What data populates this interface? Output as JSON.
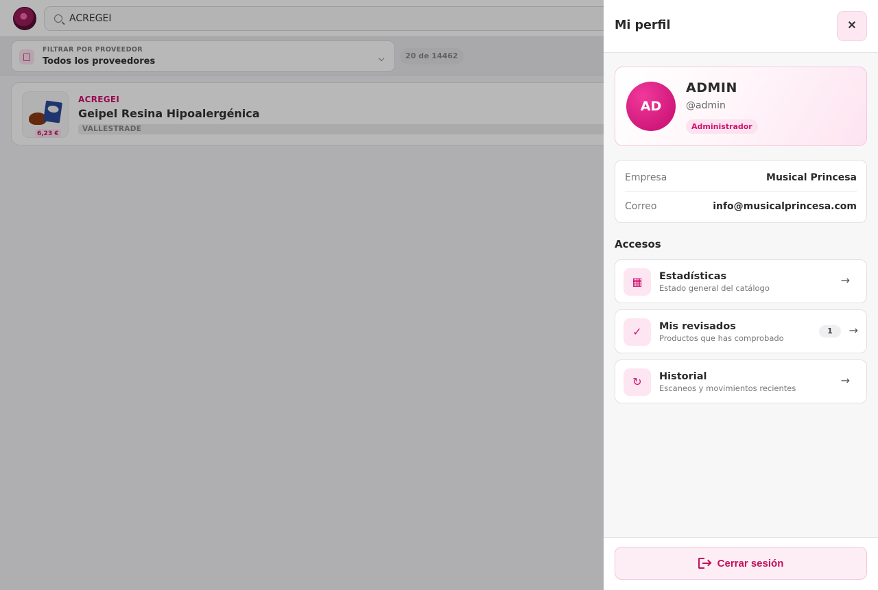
{
  "background": {
    "search": {
      "value": "ACREGEI"
    },
    "filter": {
      "label": "FILTRAR POR PROVEEDOR",
      "value": "Todos los proveedores"
    },
    "result_count": "20 de 14462",
    "products": [
      {
        "code": "ACREGEI",
        "name": "Geipel Resina Hipoalergénica",
        "vendor": "VALLESTRADE",
        "price": "6,23 €"
      }
    ]
  },
  "drawer": {
    "title": "Mi perfil",
    "close_label": "✕",
    "profile": {
      "initials": "AD",
      "name": "ADMIN",
      "handle": "@admin",
      "role": "Administrador"
    },
    "info": [
      {
        "key": "Empresa",
        "value": "Musical Princesa"
      },
      {
        "key": "Correo",
        "value": "info@musicalprincesa.com"
      }
    ],
    "section_title": "Accesos",
    "links": [
      {
        "icon": "grid-icon",
        "glyph": "▦",
        "title": "Estadísticas",
        "subtitle": "Estado general del catálogo",
        "arrow": "→"
      },
      {
        "icon": "check-icon",
        "glyph": "✓",
        "title": "Mis revisados",
        "subtitle": "Productos que has comprobado",
        "count": "1",
        "arrow": "→"
      },
      {
        "icon": "refresh-icon",
        "glyph": "↻",
        "title": "Historial",
        "subtitle": "Escaneos y movimientos recientes",
        "arrow": "→"
      }
    ],
    "logout_label": "Cerrar sesión"
  },
  "colors": {
    "accent": "#d0106e",
    "accent_soft": "#fde5f1",
    "overlay": "rgba(0,0,0,0.28)"
  }
}
